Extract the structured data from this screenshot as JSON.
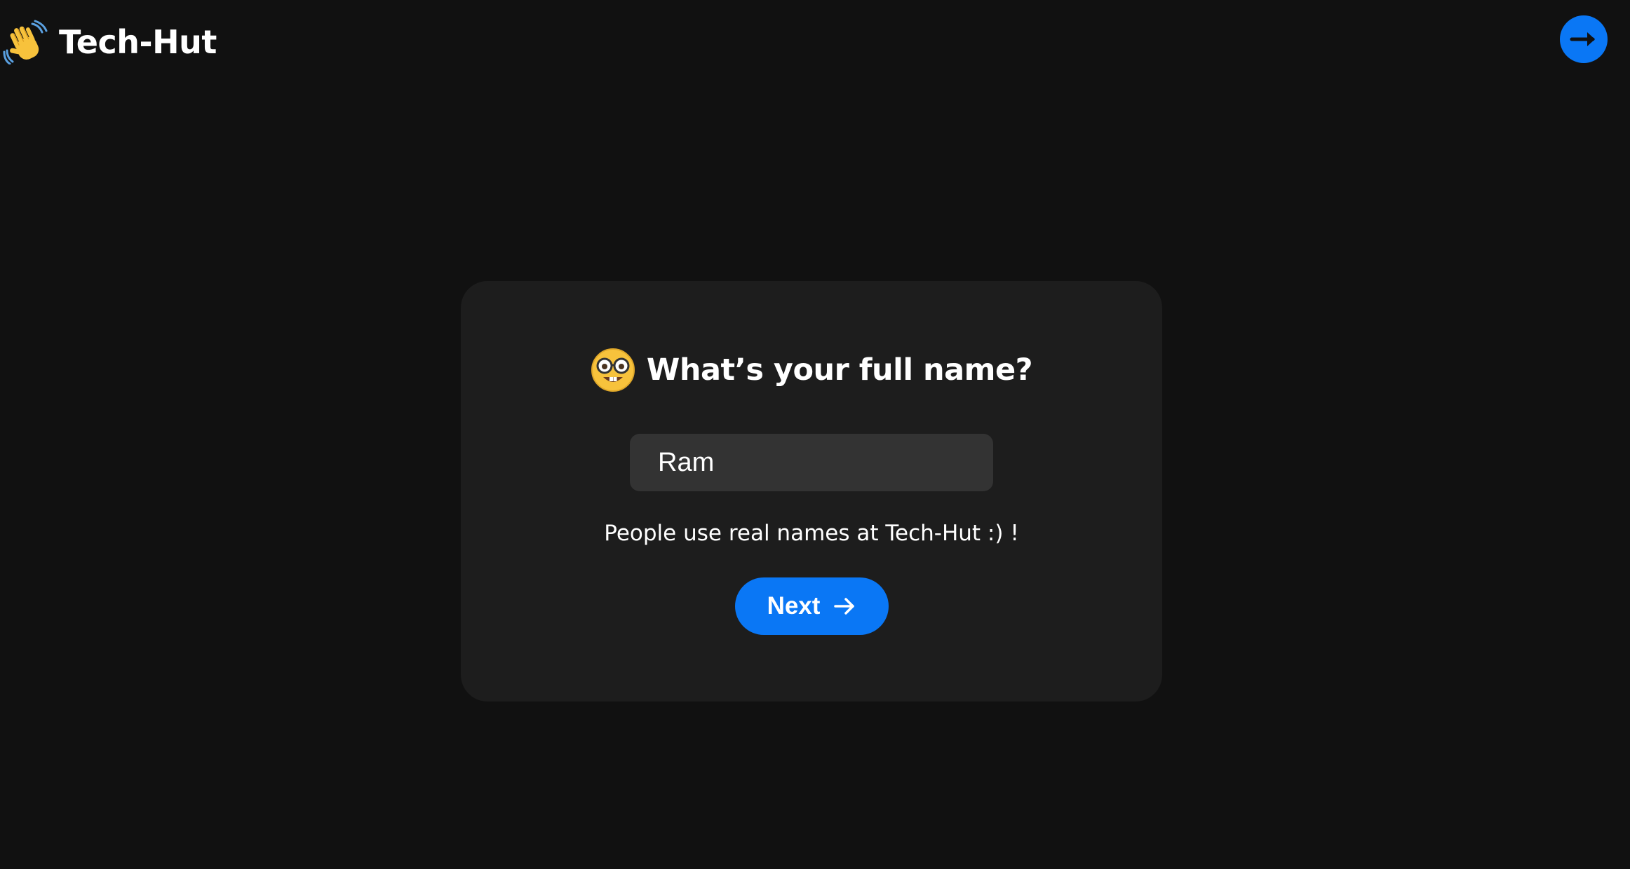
{
  "header": {
    "brand_name": "Tech-Hut",
    "brand_icon": "waving-hand-icon",
    "exit_icon": "arrow-right-icon"
  },
  "card": {
    "question_icon": "nerd-face-icon",
    "question": "What’s your full name?",
    "name_input": {
      "value": "Ram",
      "placeholder": ""
    },
    "hint": "People use real names at Tech-Hut :) !",
    "next_button": {
      "label": "Next",
      "icon": "arrow-right-icon"
    }
  },
  "colors": {
    "background": "#111111",
    "card": "#1d1d1d",
    "input": "#333333",
    "accent": "#0a77f5",
    "text": "#ffffff"
  }
}
